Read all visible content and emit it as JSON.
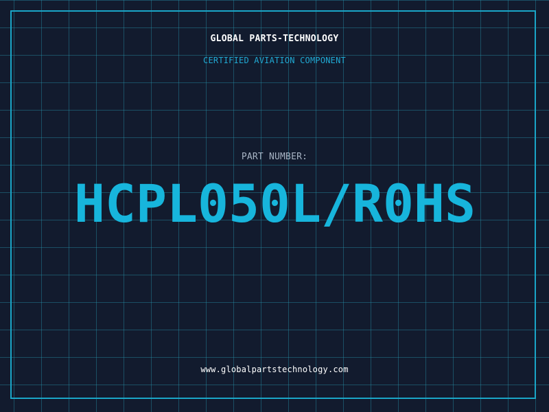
{
  "header": {
    "company": "GLOBAL PARTS-TECHNOLOGY",
    "tagline": "CERTIFIED AVIATION COMPONENT"
  },
  "part": {
    "label": "PART NUMBER:",
    "number": "HCPL050L/R0HS"
  },
  "footer": {
    "url": "www.globalpartstechnology.com"
  },
  "colors": {
    "background": "#121b2e",
    "grid": "#2896af",
    "frame": "#1aa6c8",
    "accent": "#17b5dc",
    "label": "#a8b4c4",
    "text": "#ffffff"
  }
}
